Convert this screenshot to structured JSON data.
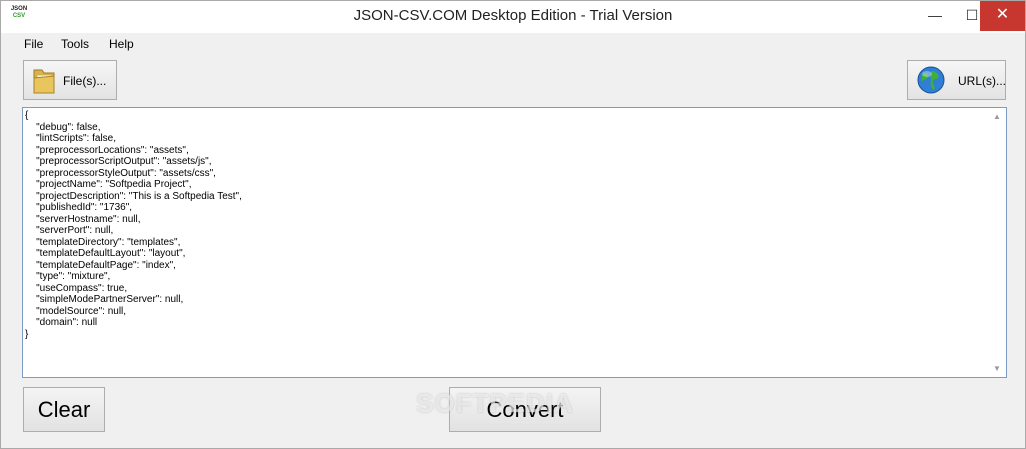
{
  "window": {
    "title": "JSON-CSV.COM Desktop Edition - Trial Version",
    "icon_line1": "JSON",
    "icon_line2": "CSV",
    "minimize_glyph": "—",
    "maximize_glyph": "☐",
    "close_glyph": "✕"
  },
  "menu": {
    "items": [
      {
        "label": "File"
      },
      {
        "label": "Tools"
      },
      {
        "label": "Help"
      }
    ]
  },
  "toolbar": {
    "files_label": "File(s)...",
    "files_icon": "folder-icon",
    "url_label": "URL(s)...",
    "url_icon": "globe-icon"
  },
  "editor": {
    "content": "{\n    \"debug\": false,\n    \"lintScripts\": false,\n    \"preprocessorLocations\": \"assets\",\n    \"preprocessorScriptOutput\": \"assets/js\",\n    \"preprocessorStyleOutput\": \"assets/css\",\n    \"projectName\": \"Softpedia Project\",\n    \"projectDescription\": \"This is a Softpedia Test\",\n    \"publishedId\": \"1736\",\n    \"serverHostname\": null,\n    \"serverPort\": null,\n    \"templateDirectory\": \"templates\",\n    \"templateDefaultLayout\": \"layout\",\n    \"templateDefaultPage\": \"index\",\n    \"type\": \"mixture\",\n    \"useCompass\": true,\n    \"simpleModePartnerServer\": null,\n    \"modelSource\": null,\n    \"domain\": null\n}"
  },
  "actions": {
    "clear_label": "Clear",
    "convert_label": "Convert"
  },
  "watermark": "SOFTPEDIA",
  "colors": {
    "close_button": "#c7372f",
    "editor_border": "#7a9cc6"
  }
}
